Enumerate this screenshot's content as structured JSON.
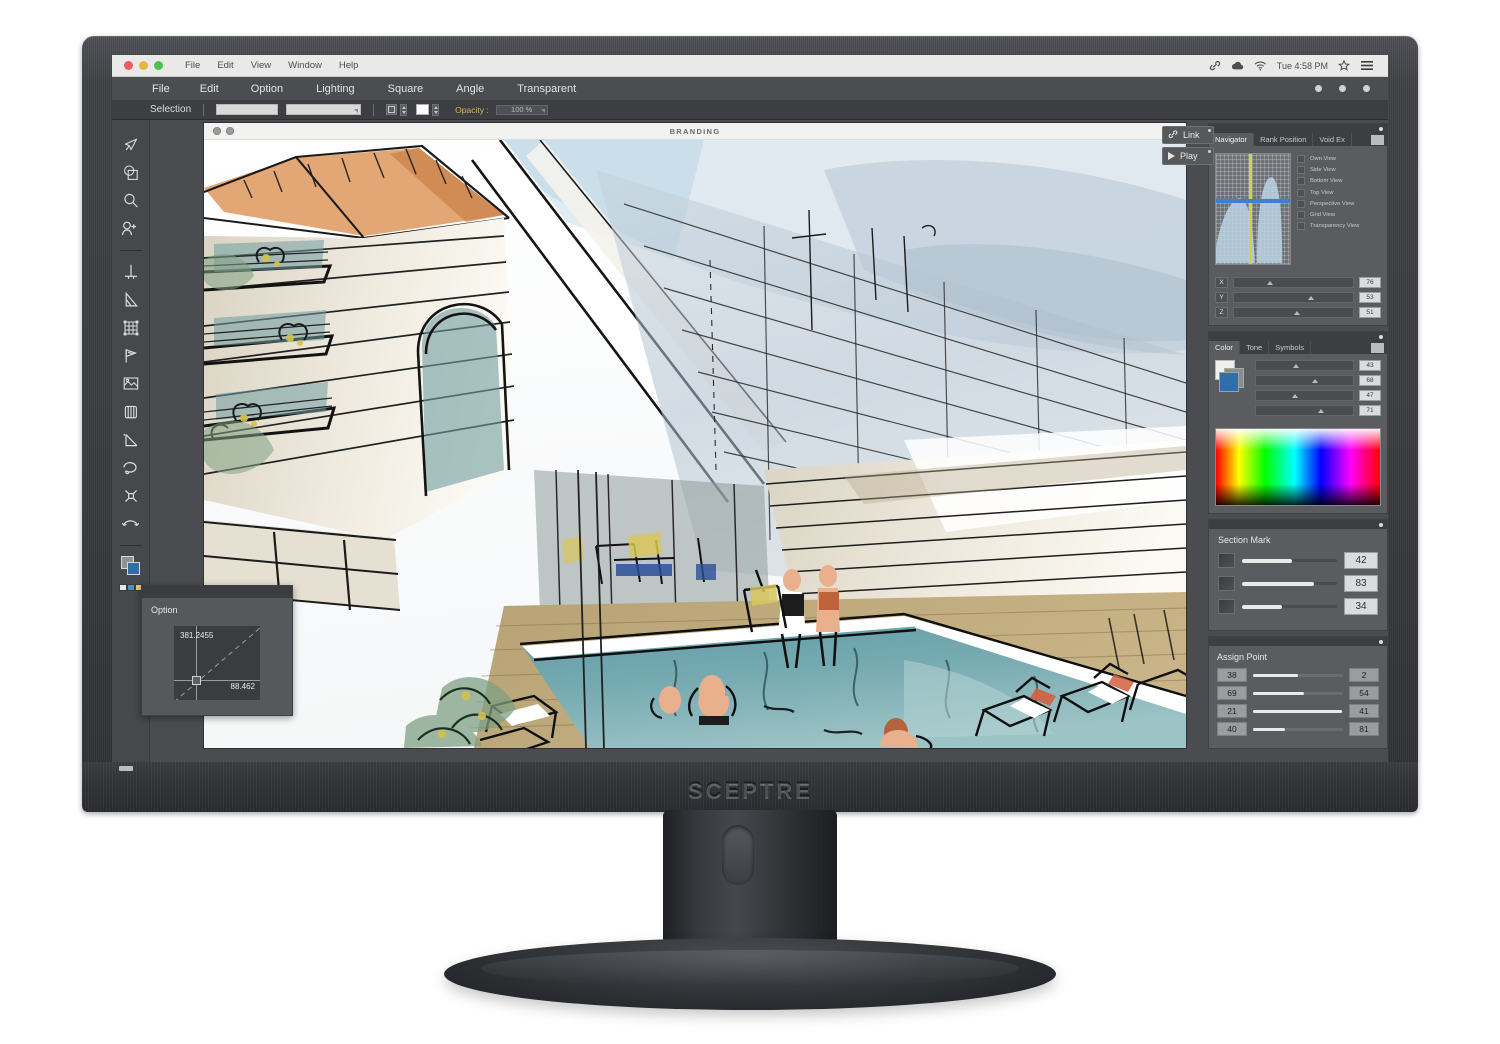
{
  "monitor": {
    "brand": "SCEPTRE"
  },
  "os_bar": {
    "menus": [
      "File",
      "Edit",
      "View",
      "Window",
      "Help"
    ],
    "icons": [
      "link-icon",
      "cloud-icon",
      "wifi-icon",
      "star-icon",
      "hamburger-icon"
    ],
    "clock": "Tue 4:58 PM"
  },
  "app_menu": {
    "items": [
      "File",
      "Edit",
      "Option",
      "Lighting",
      "Square",
      "Angle",
      "Transparent"
    ]
  },
  "options_bar": {
    "tool_label": "Selection",
    "opacity_label": "Opacity :",
    "opacity_value": "100 %"
  },
  "tools": [
    "cursor-arrow-tool",
    "shapes-tool",
    "magnifier-tool",
    "add-person-tool",
    "perpendicular-tool",
    "angle-triangle-tool",
    "transform-grid-tool",
    "flag-measure-tool",
    "terrain-tool",
    "column-tool",
    "corner-angle-tool",
    "lasso-tool",
    "pin-tool",
    "rotate-tool"
  ],
  "document": {
    "title": "BRANDING",
    "artwork_caption": "watercolor architectural sketch of a modern house with swimming pool and lounge chairs"
  },
  "canvas_buttons": [
    {
      "label": "Link",
      "icon": "chain-link-icon"
    },
    {
      "label": "Play",
      "icon": "play-triangle-icon"
    }
  ],
  "option_panel": {
    "title": "Option",
    "value_top": "381.2455",
    "value_bottom": "88.462"
  },
  "navigator_panel": {
    "tabs": [
      "Navigator",
      "Rank Position",
      "Void Ex"
    ],
    "active_tab": "Navigator",
    "view_options": [
      "Own View",
      "Side View",
      "Bottom View",
      "Top View",
      "Perspective View",
      "Grid View",
      "Transparency View"
    ],
    "axes": [
      {
        "key": "X",
        "value": "76",
        "pos": 28
      },
      {
        "key": "Y",
        "value": "53",
        "pos": 62
      },
      {
        "key": "Z",
        "value": "51",
        "pos": 50
      }
    ]
  },
  "color_panel": {
    "tabs": [
      "Color",
      "Tone",
      "Symbols"
    ],
    "active_tab": "Color",
    "sliders": [
      {
        "value": "43",
        "pos": 38
      },
      {
        "value": "68",
        "pos": 58
      },
      {
        "value": "47",
        "pos": 37
      },
      {
        "value": "71",
        "pos": 64
      }
    ]
  },
  "section_mark_panel": {
    "title": "Section Mark",
    "rows": [
      {
        "value": "42",
        "fill": 53
      },
      {
        "value": "83",
        "fill": 76
      },
      {
        "value": "34",
        "fill": 42
      }
    ]
  },
  "assign_point_panel": {
    "title": "Assign Point",
    "rows": [
      {
        "left": "38",
        "right": "2",
        "fill": 50
      },
      {
        "left": "69",
        "right": "54",
        "fill": 57
      },
      {
        "left": "21",
        "right": "41",
        "fill": 99
      },
      {
        "left": "40",
        "right": "81",
        "fill": 36
      }
    ]
  },
  "colors": {
    "bezel": "#3a3c40",
    "screen_bg": "#4a4c50",
    "panel_bg": "#5a5c60",
    "accent_yellow": "#cfd63a",
    "accent_blue": "#3e7fd0",
    "opacity_label": "#d6b46a"
  }
}
